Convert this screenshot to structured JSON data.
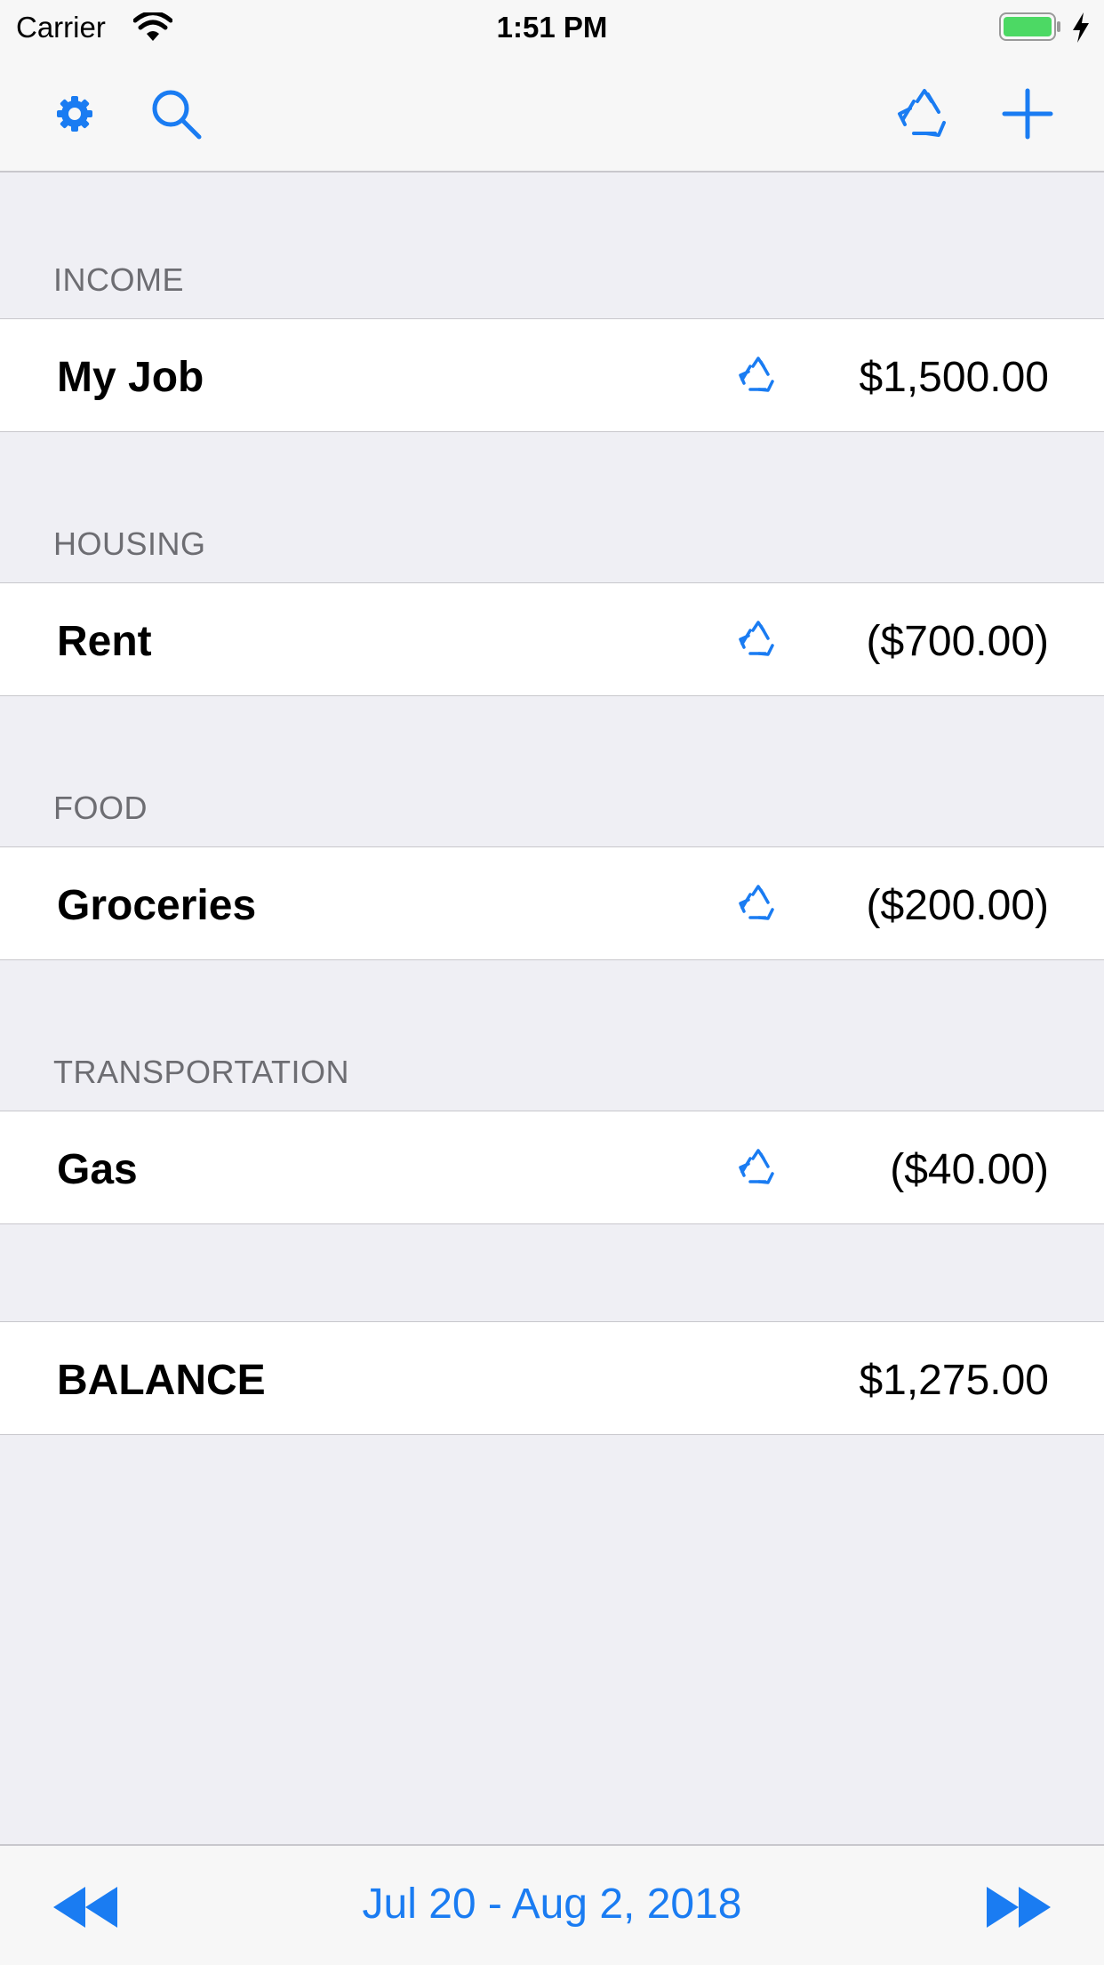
{
  "status_bar": {
    "carrier": "Carrier",
    "time": "1:51 PM"
  },
  "nav": {
    "left_icons": [
      "settings-icon",
      "search-icon"
    ],
    "right_icons": [
      "recycle-icon",
      "add-icon"
    ]
  },
  "accent_color": "#1a7cf2",
  "sections": [
    {
      "header": "INCOME",
      "items": [
        {
          "name": "My Job",
          "recurring": true,
          "amount": "$1,500.00"
        }
      ]
    },
    {
      "header": "HOUSING",
      "items": [
        {
          "name": "Rent",
          "recurring": true,
          "amount": "($700.00)"
        }
      ]
    },
    {
      "header": "FOOD",
      "items": [
        {
          "name": "Groceries",
          "recurring": true,
          "amount": "($200.00)"
        }
      ]
    },
    {
      "header": "TRANSPORTATION",
      "items": [
        {
          "name": "Gas",
          "recurring": true,
          "amount": "($40.00)"
        }
      ]
    }
  ],
  "balance": {
    "label": "BALANCE",
    "amount": "$1,275.00"
  },
  "footer": {
    "date_range": "Jul 20 - Aug 2, 2018"
  }
}
